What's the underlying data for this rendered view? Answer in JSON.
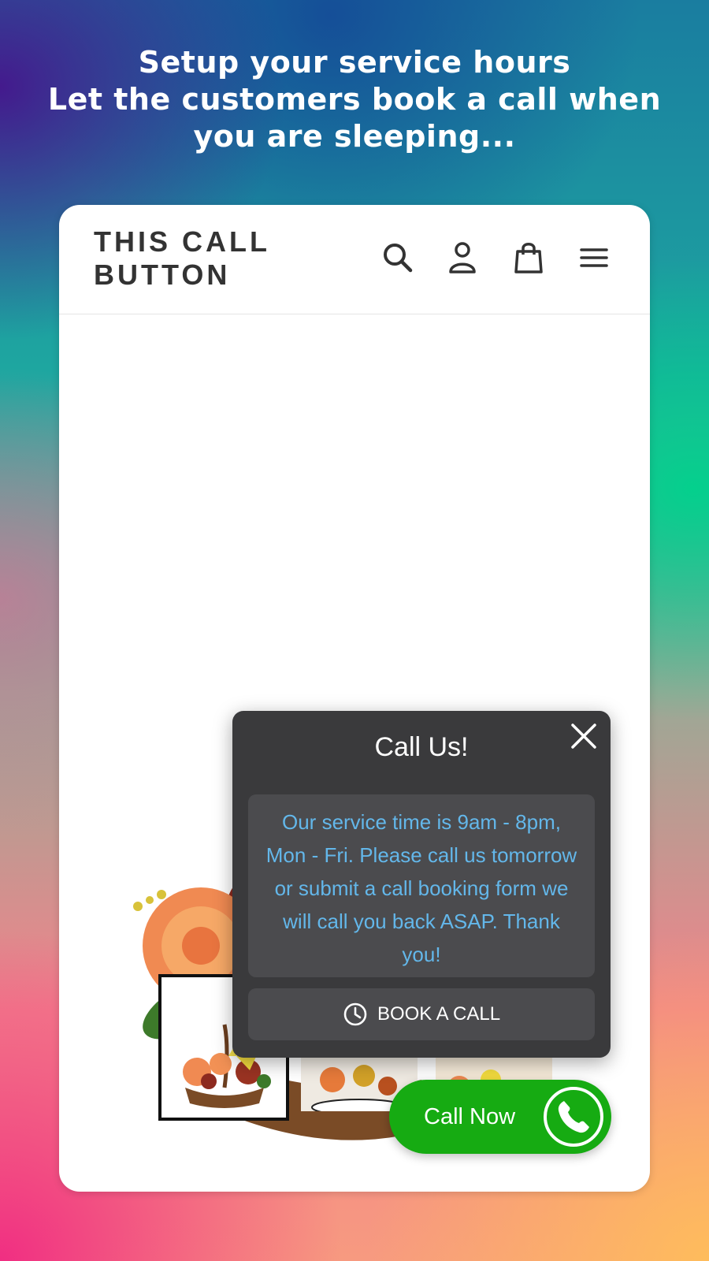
{
  "headline": {
    "line1": "Setup your service hours",
    "line2": "Let the customers book a call when",
    "line3": "you are sleeping..."
  },
  "store": {
    "brand_line1": "THIS CALL",
    "brand_line2": "BUTTON",
    "icons": [
      "search-icon",
      "account-icon",
      "cart-icon",
      "menu-icon"
    ]
  },
  "popup": {
    "title": "Call Us!",
    "message": "Our service time is 9am - 8pm, Mon - Fri. Please call us tomorrow or submit a call booking form we will call you back ASAP. Thank you!",
    "book_button_label": "BOOK A CALL",
    "close_icon": "close-icon",
    "message_color": "#63b7ea",
    "background_color": "#3a3a3c"
  },
  "call_now": {
    "label": "Call Now",
    "icon": "phone-icon",
    "color": "#16ab12"
  }
}
